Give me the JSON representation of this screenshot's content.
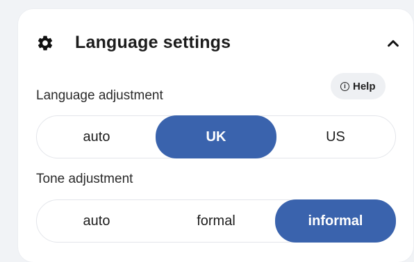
{
  "panel": {
    "title": "Language settings",
    "icons": {
      "settings": "gear-icon",
      "collapse": "chevron-up-icon",
      "help": "info-icon"
    },
    "help_label": "Help"
  },
  "language_adjustment": {
    "label": "Language adjustment",
    "options": [
      "auto",
      "UK",
      "US"
    ],
    "selected": "UK"
  },
  "tone_adjustment": {
    "label": "Tone adjustment",
    "options": [
      "auto",
      "formal",
      "informal"
    ],
    "selected": "informal"
  },
  "colors": {
    "accent": "#3a63ad",
    "background": "#f1f3f6",
    "panel": "#ffffff",
    "help_bg": "#eef0f3"
  }
}
